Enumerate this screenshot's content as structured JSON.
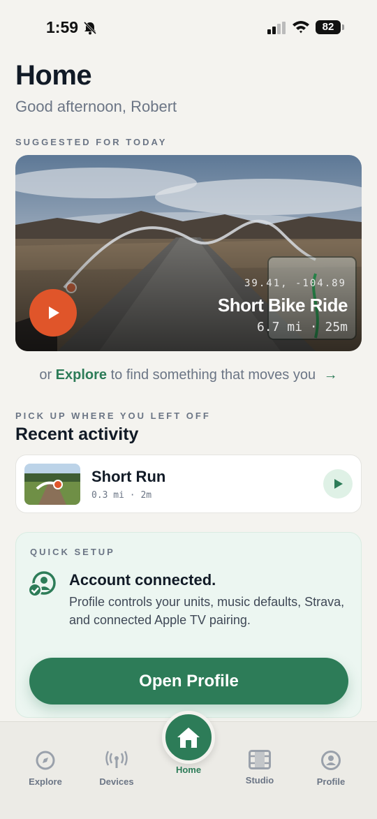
{
  "status": {
    "time": "1:59",
    "battery": "82"
  },
  "page": {
    "title": "Home",
    "greeting": "Good afternoon, Robert"
  },
  "suggested": {
    "section_label": "SUGGESTED FOR TODAY",
    "coords": "39.41, -104.89",
    "title": "Short Bike Ride",
    "stats": "6.7 mi · 25m",
    "accent": "#e0552a"
  },
  "explore_line": {
    "prefix": "or ",
    "link": "Explore",
    "suffix": " to find something that moves you",
    "arrow": "→"
  },
  "recent": {
    "section_label": "PICK UP WHERE YOU LEFT OFF",
    "title": "Recent activity",
    "items": [
      {
        "name": "Short Run",
        "stats": "0.3 mi · 2m"
      }
    ]
  },
  "setup": {
    "label": "QUICK SETUP",
    "heading": "Account connected.",
    "description": "Profile controls your units, music defaults, Strava, and connected Apple TV pairing.",
    "button": "Open Profile",
    "accent": "#2d7c58"
  },
  "tabs": {
    "explore": "Explore",
    "devices": "Devices",
    "home": "Home",
    "studio": "Studio",
    "profile": "Profile"
  }
}
